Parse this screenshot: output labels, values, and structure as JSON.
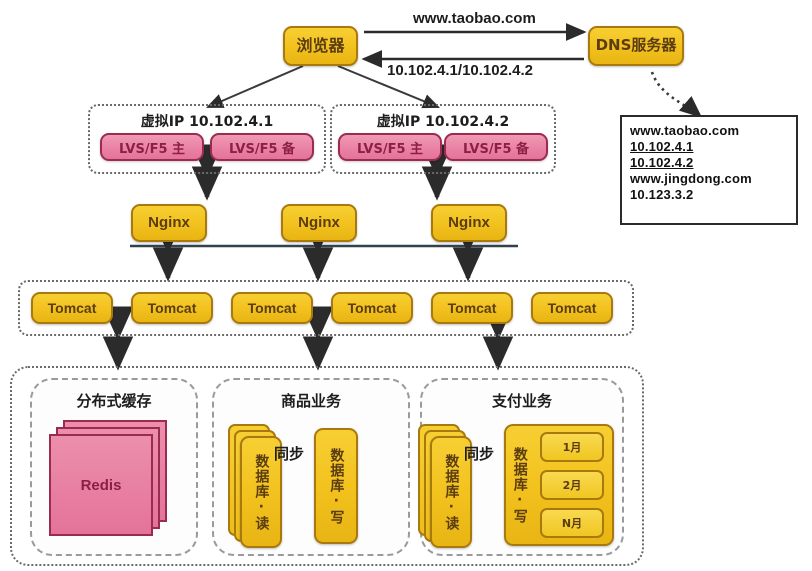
{
  "diagram": {
    "title": "Taobao large-scale website architecture",
    "colors": {
      "gold_fill": "#f2c11d",
      "gold_border": "#a8790c",
      "gold_text": "#5b3d10",
      "pink_fill": "#e4739a",
      "pink_border": "#9c2b52",
      "pink_text": "#8d1f45",
      "arrow": "#2b2b2b",
      "dotted_border": "#6a6a6a"
    }
  },
  "client_layer": {
    "browser_label": "浏览器",
    "dns_server_label": "DNS服务器",
    "request_label": "www.taobao.com",
    "response_label": "10.102.4.1/10.102.4.2"
  },
  "dns_records": {
    "lines": [
      {
        "text": "www.taobao.com",
        "underline": false
      },
      {
        "text": "10.102.4.1",
        "underline": true
      },
      {
        "text": "10.102.4.2",
        "underline": true
      },
      {
        "text": "www.jingdong.com",
        "underline": false
      },
      {
        "text": "10.123.3.2",
        "underline": false
      }
    ]
  },
  "lvs_layer": {
    "groups": [
      {
        "title": "虚拟IP 10.102.4.1",
        "nodes": [
          {
            "label": "LVS/F5 主"
          },
          {
            "label": "LVS/F5 备"
          }
        ]
      },
      {
        "title": "虚拟IP 10.102.4.2",
        "nodes": [
          {
            "label": "LVS/F5 主"
          },
          {
            "label": "LVS/F5 备"
          }
        ]
      }
    ]
  },
  "nginx_layer": {
    "nodes": [
      {
        "label": "Nginx"
      },
      {
        "label": "Nginx"
      },
      {
        "label": "Nginx"
      }
    ]
  },
  "tomcat_layer": {
    "nodes": [
      {
        "label": "Tomcat"
      },
      {
        "label": "Tomcat"
      },
      {
        "label": "Tomcat"
      },
      {
        "label": "Tomcat"
      },
      {
        "label": "Tomcat"
      },
      {
        "label": "Tomcat"
      }
    ]
  },
  "data_layer": {
    "cache_group": {
      "title": "分布式缓存",
      "node_label": "Redis",
      "stack_count": 3
    },
    "product_group": {
      "title": "商品业务",
      "read_db_label": "数据库·读",
      "write_db_label": "数据库·写",
      "sync_label": "同步",
      "read_stack_count": 3
    },
    "payment_group": {
      "title": "支付业务",
      "read_db_label": "数据库·读",
      "write_db_label": "数据库·写",
      "sync_label": "同步",
      "read_stack_count": 3,
      "partitions": [
        {
          "label": "1月"
        },
        {
          "label": "2月"
        },
        {
          "label": "N月"
        }
      ]
    }
  }
}
